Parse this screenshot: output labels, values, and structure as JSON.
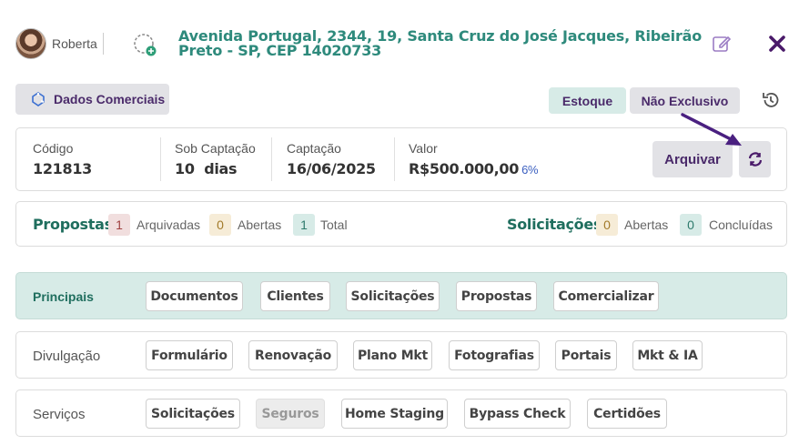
{
  "header": {
    "user_name": "Roberta",
    "address": "Avenida Portugal, 2344, 19, Santa Cruz do José Jacques, Ribeirão Preto - SP, CEP 14020733",
    "icons": [
      "avatar",
      "add-user-icon",
      "edit-icon",
      "close-icon"
    ]
  },
  "toolbar": {
    "dados_label": "Dados Comerciais",
    "estoque_label": "Estoque",
    "exclusivo_label": "Não Exclusivo"
  },
  "info": {
    "codigo_label": "Código",
    "codigo_value": "121813",
    "sob_label": "Sob Captação",
    "sob_value": "10  dias",
    "captacao_label": "Captação",
    "captacao_value": "16/06/2025",
    "valor_label": "Valor",
    "valor_value": "R$500.000,00",
    "valor_pct": "6%",
    "arquivar_label": "Arquivar"
  },
  "propostas": {
    "title": "Propostas",
    "arquivadas_count": "1",
    "arquivadas_label": "Arquivadas",
    "abertas_count": "0",
    "abertas_label": "Abertas",
    "total_count": "1",
    "total_label": "Total"
  },
  "solicitacoes": {
    "title": "Solicitações",
    "abertas_count": "0",
    "abertas_label": "Abertas",
    "concluidas_count": "0",
    "concluidas_label": "Concluídas"
  },
  "nav": {
    "principais": {
      "label": "Principais",
      "items": [
        "Documentos",
        "Clientes",
        "Solicitações",
        "Propostas",
        "Comercializar"
      ]
    },
    "divulgacao": {
      "label": "Divulgação",
      "items": [
        "Formulário",
        "Renovação",
        "Plano Mkt",
        "Fotografias",
        "Portais",
        "Mkt & IA"
      ]
    },
    "servicos": {
      "label": "Serviços",
      "items": [
        "Solicitações",
        "Seguros",
        "Home Staging",
        "Bypass Check",
        "Certidões"
      ]
    }
  },
  "colors": {
    "accent_teal": "#2e8a7c",
    "accent_purple": "#4a2a6a",
    "annotation_arrow": "#4a2080"
  }
}
